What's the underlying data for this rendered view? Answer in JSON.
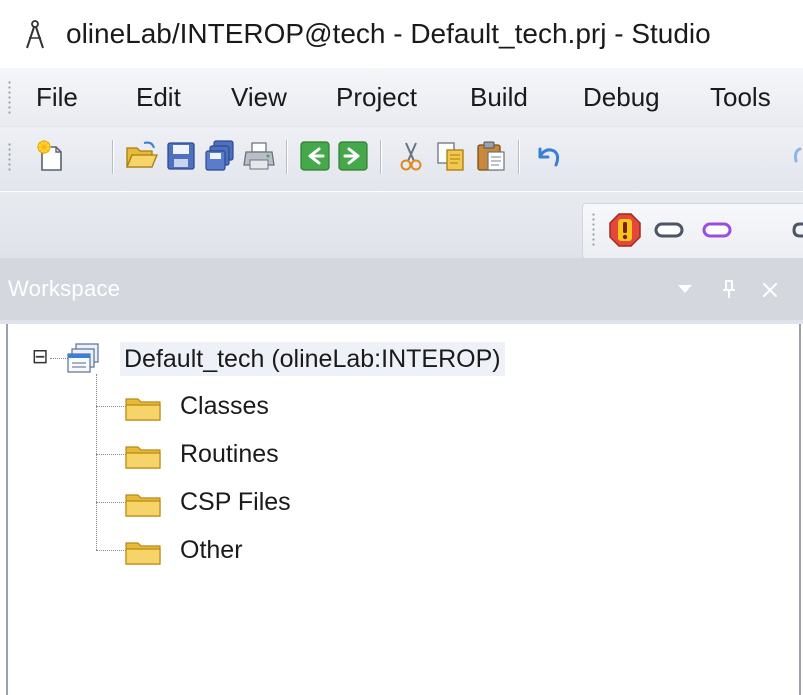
{
  "window": {
    "title": "olineLab/INTEROP@tech - Default_tech.prj - Studio",
    "app_icon": "compass-icon"
  },
  "menubar": {
    "items": [
      {
        "label": "File"
      },
      {
        "label": "Edit"
      },
      {
        "label": "View"
      },
      {
        "label": "Project"
      },
      {
        "label": "Build"
      },
      {
        "label": "Debug"
      },
      {
        "label": "Tools"
      }
    ]
  },
  "toolbar": {
    "buttons": [
      {
        "icon": "new-document-icon"
      },
      {
        "icon": "open-folder-icon"
      },
      {
        "icon": "save-icon"
      },
      {
        "icon": "save-all-icon"
      },
      {
        "icon": "print-icon"
      },
      {
        "icon": "back-arrow-icon"
      },
      {
        "icon": "forward-arrow-icon"
      },
      {
        "icon": "cut-icon"
      },
      {
        "icon": "copy-icon"
      },
      {
        "icon": "paste-icon"
      },
      {
        "icon": "undo-icon"
      }
    ]
  },
  "toolbar2": {
    "buttons": [
      {
        "icon": "alert-icon"
      },
      {
        "icon": "gray-shape-icon"
      },
      {
        "icon": "purple-shape-icon"
      }
    ]
  },
  "workspace": {
    "title": "Workspace",
    "controls": [
      "dropdown-icon",
      "pin-icon",
      "close-icon"
    ]
  },
  "tree": {
    "root": {
      "label": "Default_tech  (olineLab:INTEROP)",
      "expander": "⊟"
    },
    "children": [
      {
        "label": "Classes"
      },
      {
        "label": "Routines"
      },
      {
        "label": "CSP Files"
      },
      {
        "label": "Other"
      }
    ]
  },
  "colors": {
    "menu_bg": "#eceef3",
    "panel_header": "#d4d7de",
    "folder_fill": "#f3c94d",
    "folder_edge": "#b88a13",
    "alert_red": "#e4473b",
    "shape_purple": "#9b4de0"
  }
}
